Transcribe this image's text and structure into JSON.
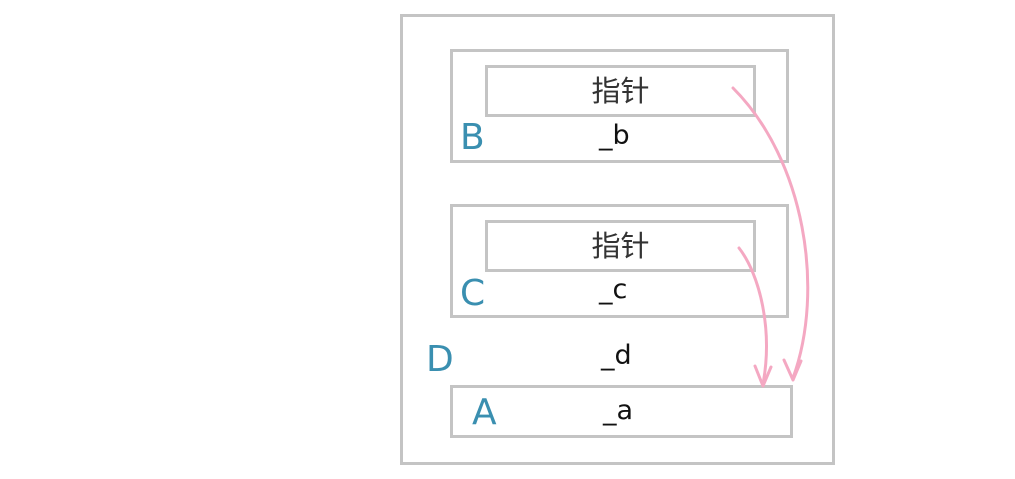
{
  "struct_d": {
    "label": "D",
    "field": "_d"
  },
  "struct_b": {
    "label": "B",
    "field": "_b",
    "pointer_label": "指针"
  },
  "struct_c": {
    "label": "C",
    "field": "_c",
    "pointer_label": "指针"
  },
  "struct_a": {
    "label": "A",
    "field": "_a"
  },
  "colors": {
    "border": "#c4c4c4",
    "label": "#3a8fb0",
    "arrow": "#f4a8c2",
    "text": "#111111"
  }
}
